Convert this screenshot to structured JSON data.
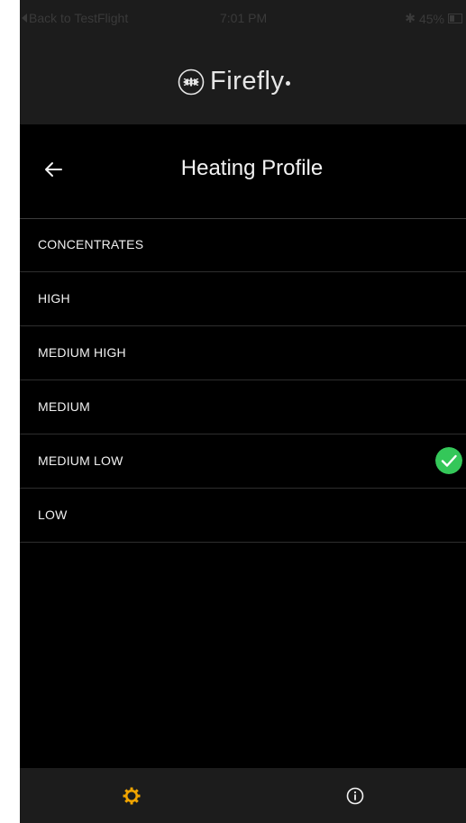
{
  "status_bar": {
    "back_label": "Back to TestFlight",
    "time": "7:01 PM",
    "battery": "45%",
    "battery_level": 0.45,
    "icons": [
      "back-triangle-icon",
      "bluetooth-icon",
      "battery-icon"
    ]
  },
  "header": {
    "brand": "Firefly",
    "logo_icon": "firefly-logo-icon"
  },
  "title_bar": {
    "title": "Heating Profile",
    "back_icon": "arrow-left-icon"
  },
  "profiles": {
    "items": [
      {
        "label": "CONCENTRATES",
        "selected": false
      },
      {
        "label": "HIGH",
        "selected": false
      },
      {
        "label": "MEDIUM HIGH",
        "selected": false
      },
      {
        "label": "MEDIUM",
        "selected": false
      },
      {
        "label": "MEDIUM LOW",
        "selected": true
      },
      {
        "label": "LOW",
        "selected": false
      }
    ],
    "selected_icon": "check-circle-icon"
  },
  "tab_bar": {
    "tabs": [
      {
        "icon": "gear-icon",
        "active": true
      },
      {
        "icon": "info-icon",
        "active": false
      }
    ]
  },
  "colors": {
    "background": "#000000",
    "chrome": "#1c1c1c",
    "text": "#f0f0f0",
    "accent_active_tab": "#f0a400",
    "check_green": "#34c759",
    "divider": "#2e2e2e"
  }
}
